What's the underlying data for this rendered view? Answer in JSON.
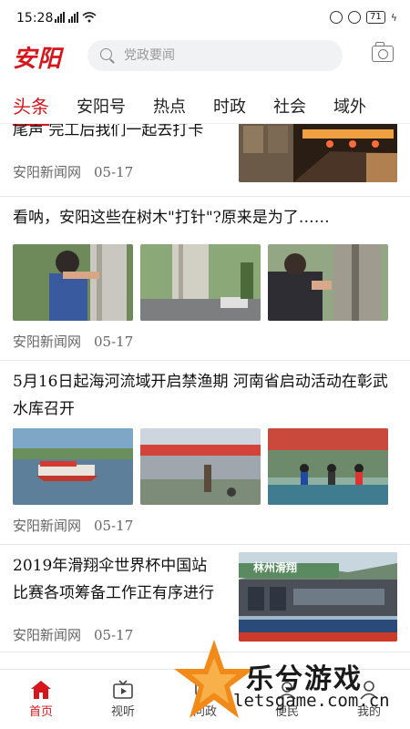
{
  "status_bar": {
    "time": "15:28",
    "battery": "71"
  },
  "header": {
    "logo": "安阳",
    "search_placeholder": "党政要闻"
  },
  "tabs": [
    {
      "label": "头条",
      "active": true
    },
    {
      "label": "安阳号"
    },
    {
      "label": "热点"
    },
    {
      "label": "时政"
    },
    {
      "label": "社会"
    },
    {
      "label": "域外"
    }
  ],
  "feed": [
    {
      "title": "尾声 完工后我们一起去打卡",
      "source": "安阳新闻网",
      "date": "05-17"
    },
    {
      "title": "看呐，安阳这些在树木\"打针\"?原来是为了……",
      "source": "安阳新闻网",
      "date": "05-17"
    },
    {
      "title": "5月16日起海河流域开启禁渔期 河南省启动活动在彰武水库召开",
      "source": "安阳新闻网",
      "date": "05-17"
    },
    {
      "title": "2019年滑翔伞世界杯中国站比赛各项筹备工作正有序进行",
      "source": "安阳新闻网",
      "date": "05-17",
      "image_caption": "林州滑翔"
    }
  ],
  "bottom_nav": [
    {
      "label": "首页",
      "icon": "home-icon",
      "active": true
    },
    {
      "label": "视听",
      "icon": "tv-icon"
    },
    {
      "label": "问政",
      "icon": "ask-icon"
    },
    {
      "label": "便民",
      "icon": "service-icon"
    },
    {
      "label": "我的",
      "icon": "profile-icon"
    }
  ],
  "watermark": {
    "title": "乐兮游戏",
    "url": "letsgame.com.cn"
  },
  "colors": {
    "accent": "#d6161d",
    "text": "#111111",
    "meta": "#666666"
  }
}
